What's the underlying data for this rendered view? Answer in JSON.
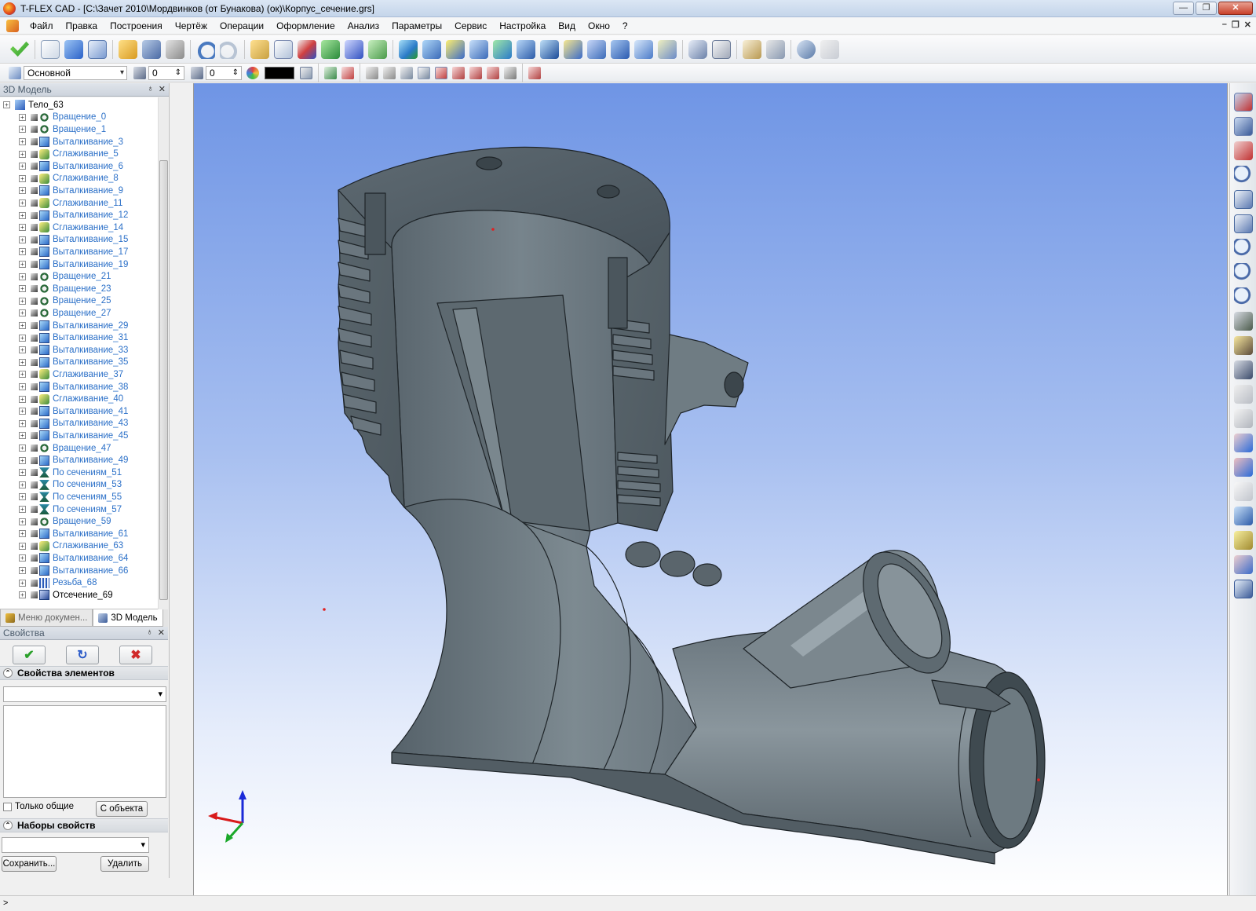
{
  "window": {
    "title": "T-FLEX CAD - [C:\\Зачет 2010\\Мордвинков (от Бунакова) (ок)\\Корпус_сечение.grs]",
    "minimize": "—",
    "maximize": "❐",
    "close": "✕"
  },
  "menu": {
    "items": [
      "Файл",
      "Правка",
      "Построения",
      "Чертёж",
      "Операции",
      "Оформление",
      "Анализ",
      "Параметры",
      "Сервис",
      "Настройка",
      "Вид",
      "Окно",
      "?"
    ],
    "mdi_buttons": [
      "–",
      "❐",
      "✕"
    ]
  },
  "toolbar2": {
    "layer": "Основной",
    "level_value": "0",
    "priority_value": "0",
    "color_hex": "#000000"
  },
  "colors": {
    "accent_blue": "#2b70c8",
    "viewport_top": "#6f95e5",
    "viewport_bottom": "#ffffff",
    "model_gray": "#6c7a83"
  },
  "model_tree": {
    "header": "3D Модель",
    "header_btns": [
      "♁",
      "✕"
    ],
    "root": "Тело_63",
    "items": [
      {
        "label": "Вращение_0",
        "icon": "rotation-icon"
      },
      {
        "label": "Вращение_1",
        "icon": "rotation-icon"
      },
      {
        "label": "Выталкивание_3",
        "icon": "extrusion-icon"
      },
      {
        "label": "Сглаживание_5",
        "icon": "smoothing-icon"
      },
      {
        "label": "Выталкивание_6",
        "icon": "extrusion-icon"
      },
      {
        "label": "Сглаживание_8",
        "icon": "smoothing-icon"
      },
      {
        "label": "Выталкивание_9",
        "icon": "extrusion-icon"
      },
      {
        "label": "Сглаживание_11",
        "icon": "smoothing-icon"
      },
      {
        "label": "Выталкивание_12",
        "icon": "extrusion-icon"
      },
      {
        "label": "Сглаживание_14",
        "icon": "smoothing-icon"
      },
      {
        "label": "Выталкивание_15",
        "icon": "extrusion-icon"
      },
      {
        "label": "Выталкивание_17",
        "icon": "extrusion-icon"
      },
      {
        "label": "Выталкивание_19",
        "icon": "extrusion-icon"
      },
      {
        "label": "Вращение_21",
        "icon": "rotation-icon"
      },
      {
        "label": "Вращение_23",
        "icon": "rotation-icon"
      },
      {
        "label": "Вращение_25",
        "icon": "rotation-icon"
      },
      {
        "label": "Вращение_27",
        "icon": "rotation-icon"
      },
      {
        "label": "Выталкивание_29",
        "icon": "extrusion-icon"
      },
      {
        "label": "Выталкивание_31",
        "icon": "extrusion-icon"
      },
      {
        "label": "Выталкивание_33",
        "icon": "extrusion-icon"
      },
      {
        "label": "Выталкивание_35",
        "icon": "extrusion-icon"
      },
      {
        "label": "Сглаживание_37",
        "icon": "smoothing-icon"
      },
      {
        "label": "Выталкивание_38",
        "icon": "extrusion-icon"
      },
      {
        "label": "Сглаживание_40",
        "icon": "smoothing-icon"
      },
      {
        "label": "Выталкивание_41",
        "icon": "extrusion-icon"
      },
      {
        "label": "Выталкивание_43",
        "icon": "extrusion-icon"
      },
      {
        "label": "Выталкивание_45",
        "icon": "extrusion-icon"
      },
      {
        "label": "Вращение_47",
        "icon": "rotation-icon"
      },
      {
        "label": "Выталкивание_49",
        "icon": "extrusion-icon"
      },
      {
        "label": "По сечениям_51",
        "icon": "loft-icon"
      },
      {
        "label": "По сечениям_53",
        "icon": "loft-icon"
      },
      {
        "label": "По сечениям_55",
        "icon": "loft-icon"
      },
      {
        "label": "По сечениям_57",
        "icon": "loft-icon"
      },
      {
        "label": "Вращение_59",
        "icon": "rotation-icon"
      },
      {
        "label": "Выталкивание_61",
        "icon": "extrusion-icon"
      },
      {
        "label": "Сглаживание_63",
        "icon": "smoothing-icon"
      },
      {
        "label": "Выталкивание_64",
        "icon": "extrusion-icon"
      },
      {
        "label": "Выталкивание_66",
        "icon": "extrusion-icon"
      },
      {
        "label": "Резьба_68",
        "icon": "thread-icon"
      },
      {
        "label": "Отсечение_69",
        "icon": "section-cut-icon",
        "dark": true
      }
    ]
  },
  "panel_tabs": [
    "Меню докумен...",
    "3D Модель"
  ],
  "properties": {
    "header": "Свойства",
    "header_btns": [
      "♁",
      "✕"
    ],
    "ok_symbol": "✔",
    "refresh_symbol": "↻",
    "cancel_symbol": "✖",
    "section_elements": "Свойства элементов",
    "only_common": "Только общие",
    "from_object": "С объекта",
    "section_sets": "Наборы свойств",
    "save": "Сохранить...",
    "delete": "Удалить"
  },
  "statusbar": {
    "prompt": ">"
  }
}
